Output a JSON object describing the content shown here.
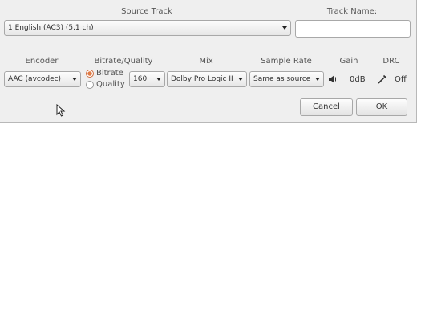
{
  "headers": {
    "source_track": "Source Track",
    "track_name": "Track Name:",
    "encoder": "Encoder",
    "bitrate_quality": "Bitrate/Quality",
    "mix": "Mix",
    "sample_rate": "Sample Rate",
    "gain": "Gain",
    "drc": "DRC"
  },
  "source_track": {
    "selected": "1  English (AC3) (5.1 ch)"
  },
  "track_name": {
    "value": ""
  },
  "encoder": {
    "selected": "AAC (avcodec)"
  },
  "rate_mode": {
    "bitrate_label": "Bitrate",
    "quality_label": "Quality",
    "selected": "Bitrate"
  },
  "bitrate": {
    "selected": "160"
  },
  "mix": {
    "selected": "Dolby Pro Logic II"
  },
  "sample_rate": {
    "selected": "Same as source"
  },
  "gain": {
    "icon": "speaker-icon",
    "value": "0dB"
  },
  "drc": {
    "icon": "drc-wand-icon",
    "value": "Off"
  },
  "buttons": {
    "cancel": "Cancel",
    "ok": "OK"
  },
  "colors": {
    "panel_bg": "#efefef",
    "radio_accent": "#e07b45"
  }
}
